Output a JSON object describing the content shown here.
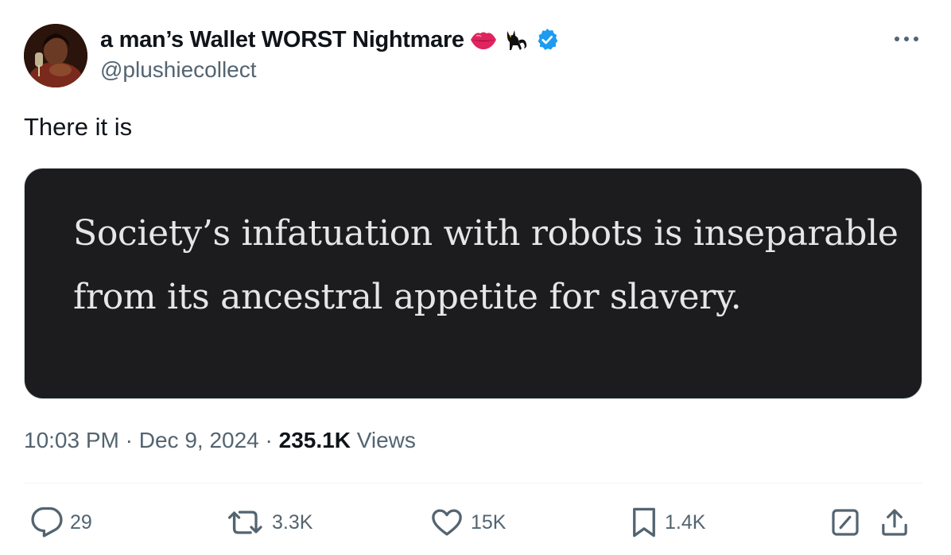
{
  "author": {
    "display_name": "a man’s Wallet WORST Nightmare",
    "handle": "@plushiecollect",
    "badges": [
      "lips-emoji-icon",
      "black-cat-emoji-icon",
      "verified-badge-icon"
    ]
  },
  "tweet": {
    "text": "There it is",
    "media_quote": "Society’s infatuation with robots is inseparable from its ancestral appetite for slavery."
  },
  "meta": {
    "time": "10:03 PM",
    "separator": "·",
    "date": "Dec 9, 2024",
    "views_count": "235.1K",
    "views_label": "Views"
  },
  "actions": {
    "replies": "29",
    "reposts": "3.3K",
    "likes": "15K",
    "bookmarks": "1.4K"
  },
  "colors": {
    "verified_blue": "#1d9bf0",
    "secondary_text": "#536471",
    "primary_text": "#0f1419",
    "media_bg": "#1c1c1e"
  }
}
